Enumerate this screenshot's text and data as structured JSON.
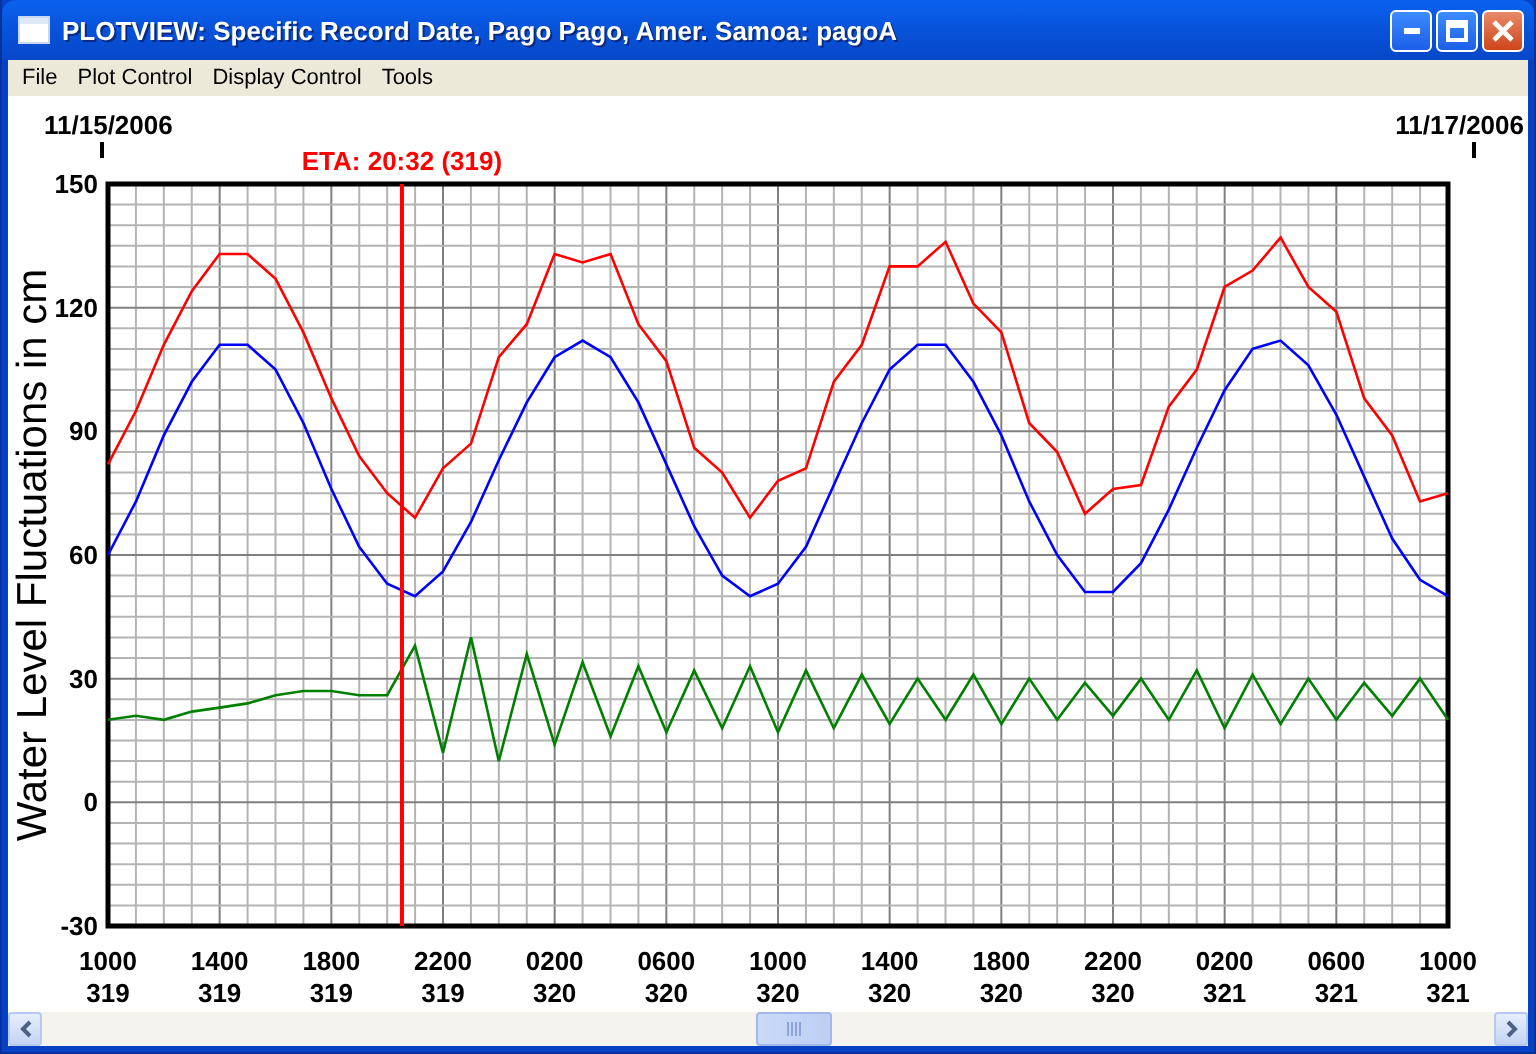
{
  "window": {
    "title": "PLOTVIEW: Specific Record Date, Pago Pago, Amer. Samoa: pagoA"
  },
  "menu": [
    {
      "label": "File"
    },
    {
      "label": "Plot Control"
    },
    {
      "label": "Display Control"
    },
    {
      "label": "Tools"
    }
  ],
  "plot": {
    "date_markers": [
      {
        "label": "11/15/2006",
        "kind": "start"
      },
      {
        "label": "11/17/2006",
        "kind": "end"
      }
    ],
    "chart_data": {
      "type": "line",
      "ylabel": "Water Level Fluctuations in cm",
      "ylim": [
        -30,
        150
      ],
      "yticks": [
        -30,
        0,
        30,
        60,
        90,
        120,
        150
      ],
      "categories": [
        "1000 319",
        null,
        null,
        null,
        "1400 319",
        null,
        null,
        null,
        "1800 319",
        null,
        null,
        null,
        "2200 319",
        null,
        null,
        null,
        "0200 320",
        null,
        null,
        null,
        "0600 320",
        null,
        null,
        null,
        "1000 320",
        null,
        null,
        null,
        "1400 320",
        null,
        null,
        null,
        "1800 320",
        null,
        null,
        null,
        "2200 320",
        null,
        null,
        null,
        "0200 321",
        null,
        null,
        null,
        "0600 321",
        null,
        null,
        null,
        "1000 321"
      ],
      "series": [
        {
          "color": "#ff0000",
          "values": [
            82,
            95,
            111,
            124,
            133,
            133,
            127,
            114,
            98,
            84,
            75,
            69,
            81,
            87,
            108,
            116,
            133,
            131,
            133,
            116,
            107,
            86,
            80,
            69,
            78,
            81,
            102,
            111,
            130,
            130,
            136,
            121,
            114,
            92,
            85,
            70,
            76,
            77,
            96,
            105,
            125,
            129,
            137,
            125,
            119,
            98,
            89,
            73,
            75
          ]
        },
        {
          "color": "#0000ff",
          "values": [
            60,
            73,
            89,
            102,
            111,
            111,
            105,
            92,
            76,
            62,
            53,
            50,
            56,
            68,
            83,
            97,
            108,
            112,
            108,
            97,
            82,
            67,
            55,
            50,
            53,
            62,
            77,
            92,
            105,
            111,
            111,
            102,
            89,
            73,
            60,
            51,
            51,
            58,
            71,
            86,
            100,
            110,
            112,
            106,
            94,
            79,
            64,
            54,
            50
          ]
        },
        {
          "color": "#008000",
          "values": [
            20,
            21,
            20,
            22,
            23,
            24,
            26,
            27,
            27,
            26,
            26,
            38,
            12,
            40,
            10,
            36,
            14,
            34,
            16,
            33,
            17,
            32,
            18,
            33,
            17,
            32,
            18,
            31,
            19,
            30,
            20,
            31,
            19,
            30,
            20,
            29,
            21,
            30,
            20,
            32,
            18,
            31,
            19,
            30,
            20,
            29,
            21,
            30,
            20
          ]
        }
      ],
      "grid": true,
      "annotations": [
        "ETA: 20:32 (319)"
      ]
    }
  }
}
